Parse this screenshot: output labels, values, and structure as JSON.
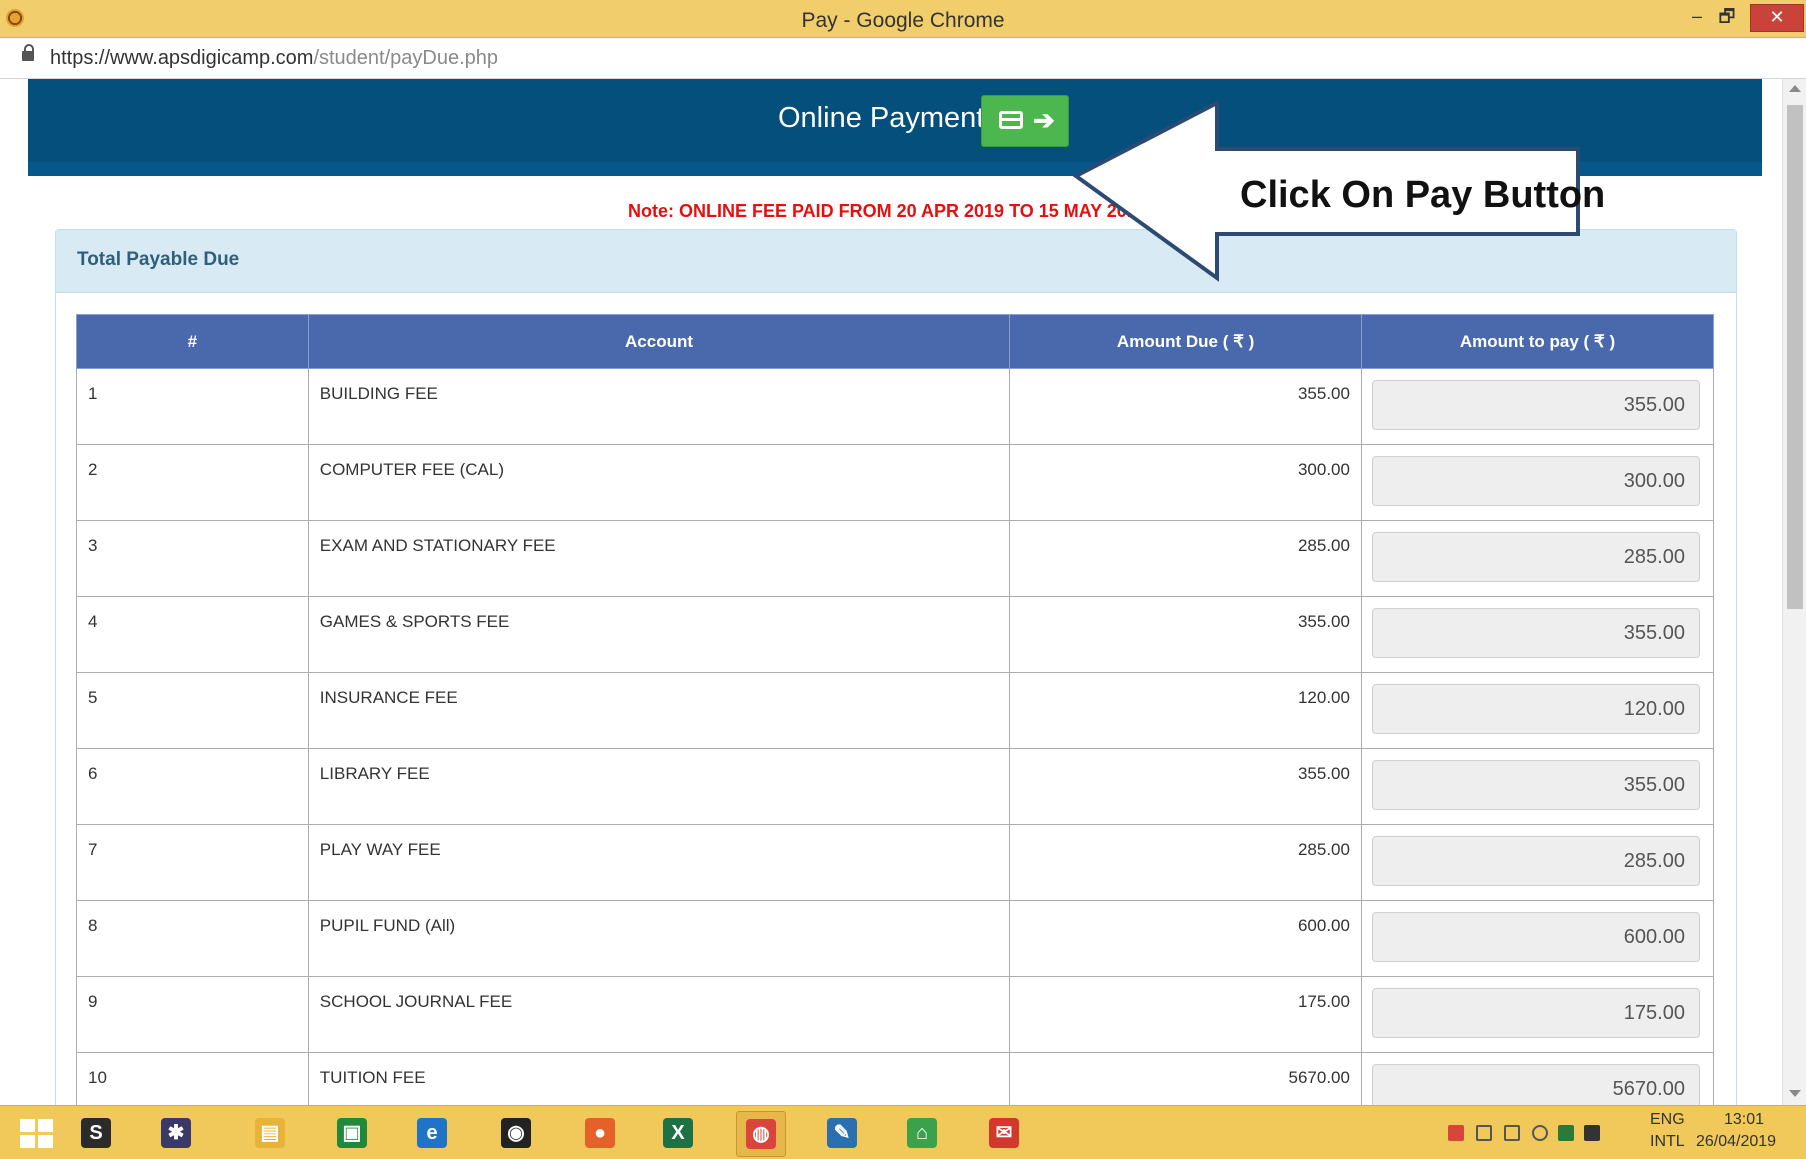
{
  "window": {
    "title": "Pay - Google Chrome",
    "minimize": "–",
    "maximize": "🗗",
    "close": "✕"
  },
  "address": {
    "host": "https://www.apsdigicamp.com",
    "path": "/student/payDue.php"
  },
  "header": {
    "title": "Online Payment",
    "pay_arrow": "➔"
  },
  "note": "Note: ONLINE FEE PAID FROM 20 APR 2019 TO 15 MAY 2019",
  "callout": "Click On Pay Button",
  "panel": {
    "heading": "Total Payable Due"
  },
  "table": {
    "headers": [
      "#",
      "Account",
      "Amount Due ( ₹ )",
      "Amount to pay ( ₹ )"
    ],
    "rows": [
      {
        "idx": "1",
        "account": "BUILDING FEE",
        "due": "355.00",
        "pay": "355.00"
      },
      {
        "idx": "2",
        "account": "COMPUTER FEE (CAL)",
        "due": "300.00",
        "pay": "300.00"
      },
      {
        "idx": "3",
        "account": "EXAM AND STATIONARY FEE",
        "due": "285.00",
        "pay": "285.00"
      },
      {
        "idx": "4",
        "account": "GAMES & SPORTS FEE",
        "due": "355.00",
        "pay": "355.00"
      },
      {
        "idx": "5",
        "account": "INSURANCE FEE",
        "due": "120.00",
        "pay": "120.00"
      },
      {
        "idx": "6",
        "account": "LIBRARY FEE",
        "due": "355.00",
        "pay": "355.00"
      },
      {
        "idx": "7",
        "account": "PLAY WAY FEE",
        "due": "285.00",
        "pay": "285.00"
      },
      {
        "idx": "8",
        "account": "PUPIL FUND (All)",
        "due": "600.00",
        "pay": "600.00"
      },
      {
        "idx": "9",
        "account": "SCHOOL JOURNAL FEE",
        "due": "175.00",
        "pay": "175.00"
      },
      {
        "idx": "10",
        "account": "TUITION FEE",
        "due": "5670.00",
        "pay": "5670.00"
      }
    ]
  },
  "taskbar": {
    "apps": [
      {
        "name": "sublime-text-icon",
        "color": "#2b2b2b",
        "glyph": "S"
      },
      {
        "name": "puzzle-app-icon",
        "color": "#3a3a6a",
        "glyph": "✱"
      },
      {
        "name": "file-explorer-icon",
        "color": "#e8b33a",
        "glyph": "▤"
      },
      {
        "name": "store-icon",
        "color": "#1f8a3a",
        "glyph": "▣"
      },
      {
        "name": "internet-explorer-icon",
        "color": "#1f74c8",
        "glyph": "e"
      },
      {
        "name": "webcam-app-icon",
        "color": "#222222",
        "glyph": "◉"
      },
      {
        "name": "firefox-icon",
        "color": "#e6612a",
        "glyph": "●"
      },
      {
        "name": "excel-icon",
        "color": "#1e7145",
        "glyph": "X"
      },
      {
        "name": "chrome-icon",
        "color": "#d9453a",
        "glyph": "◍"
      },
      {
        "name": "feather-app-icon",
        "color": "#2a6fb0",
        "glyph": "✎"
      },
      {
        "name": "house-app-icon",
        "color": "#3aa24a",
        "glyph": "⌂"
      },
      {
        "name": "acrobat-icon",
        "color": "#d2392c",
        "glyph": "✉"
      }
    ],
    "lang_top": "ENG",
    "lang_bottom": "INTL",
    "time": "13:01",
    "date": "26/04/2019"
  }
}
